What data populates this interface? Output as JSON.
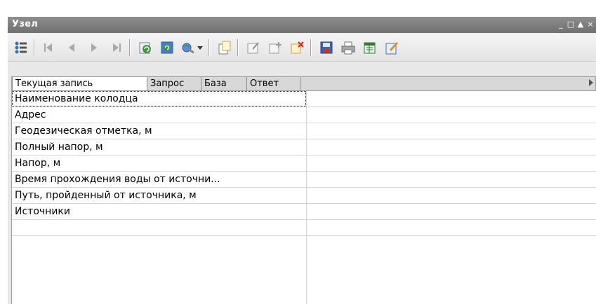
{
  "window": {
    "title": "Узел",
    "controls": {
      "minimize_glyph": "_",
      "maximize_glyph": "□",
      "rollup_glyph": "▲",
      "close_glyph": "×"
    }
  },
  "toolbar": {
    "buttons": [
      "list-view-icon",
      "first-record-icon",
      "previous-record-icon",
      "next-record-icon",
      "last-record-icon",
      "refresh-icon",
      "reload-icon",
      "map-search-icon",
      "dropdown-arrow-icon",
      "copy-document-icon",
      "edit-record-icon",
      "add-record-icon",
      "delete-record-icon",
      "save-icon",
      "print-icon",
      "export-excel-icon",
      "edit-document-icon"
    ]
  },
  "tabs": [
    {
      "label": "Текущая запись",
      "active": true
    },
    {
      "label": "Запрос",
      "active": false
    },
    {
      "label": "База",
      "active": false
    },
    {
      "label": "Ответ",
      "active": false
    }
  ],
  "grid": {
    "rows": [
      {
        "name": "Наименование колодца",
        "value": ""
      },
      {
        "name": "Адрес",
        "value": ""
      },
      {
        "name": "Геодезическая отметка, м",
        "value": ""
      },
      {
        "name": "Полный напор, м",
        "value": ""
      },
      {
        "name": "Напор, м",
        "value": ""
      },
      {
        "name": "Время прохождения воды от источни...",
        "value": ""
      },
      {
        "name": "Путь, пройденный от источника, м",
        "value": ""
      },
      {
        "name": "Источники",
        "value": ""
      },
      {
        "name": "",
        "value": ""
      }
    ]
  },
  "colors": {
    "titlebar": "#7f7f7f",
    "toolbar": "#ececec",
    "tab_active": "#ffffff",
    "grid_line": "#d4d4d4"
  }
}
